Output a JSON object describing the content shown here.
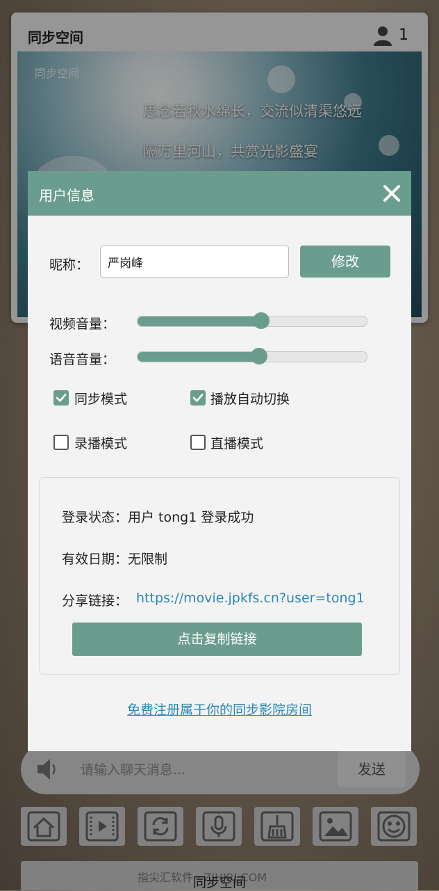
{
  "app": {
    "title": "同步空间",
    "user_count": "1",
    "banner": {
      "subtitle": "同步空间",
      "line1": "思念若秋水绵长，交流似清渠悠远",
      "line2": "隔万里河山，共赏光影盛宴"
    }
  },
  "chat": {
    "placeholder": "请输入聊天消息...",
    "send_label": "发送"
  },
  "toolbar": {
    "icons": [
      "home-icon",
      "video-icon",
      "sync-icon",
      "microphone-icon",
      "broom-icon",
      "image-icon",
      "emoji-icon"
    ]
  },
  "footer": {
    "watermark": "指尖汇软件 · ZJHJRJ.COM",
    "label": "同步空间"
  },
  "dialog": {
    "title": "用户信息",
    "nickname_label": "昵称：",
    "nickname_value": "严岗峰",
    "modify_label": "修改",
    "video_volume_label": "视频音量：",
    "video_volume": 0.54,
    "voice_volume_label": "语音音量：",
    "voice_volume": 0.53,
    "checkboxes": [
      {
        "label": "同步模式",
        "checked": true
      },
      {
        "label": "播放自动切换",
        "checked": true
      },
      {
        "label": "录播模式",
        "checked": false
      },
      {
        "label": "直播模式",
        "checked": false
      }
    ],
    "login_status_label": "登录状态：",
    "login_status_value": "用户 tong1 登录成功",
    "expiry_label": "有效日期：",
    "expiry_value": "无限制",
    "share_label": "分享链接：",
    "share_link": "https://movie.jpkfs.cn?user=tong1",
    "copy_label": "点击复制链接",
    "register_link": "免费注册属于你的同步影院房间"
  },
  "colors": {
    "accent": "#6b9d8f",
    "link": "#2a88b8"
  }
}
